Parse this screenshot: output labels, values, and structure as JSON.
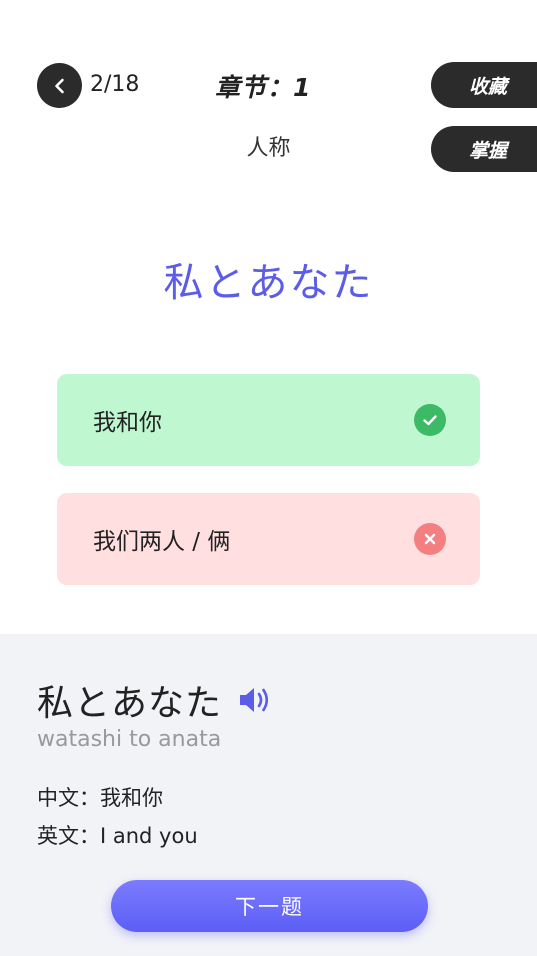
{
  "header": {
    "progress": "2/18",
    "chapter": "章节：1",
    "subtitle": "人称",
    "favorite_label": "收藏",
    "master_label": "掌握"
  },
  "question": {
    "text": "私とあなた"
  },
  "options": [
    {
      "label": "我和你",
      "status": "correct"
    },
    {
      "label": "我们两人 / 俩",
      "status": "wrong"
    }
  ],
  "detail": {
    "word": "私とあなた",
    "romaji": "watashi to anata",
    "chinese_prefix": "中文：",
    "chinese": "我和你",
    "english_prefix": "英文：",
    "english": "I and you"
  },
  "actions": {
    "next_label": "下一题"
  },
  "colors": {
    "accent": "#5b5ce8",
    "correct_bg": "#bff8d0",
    "correct_icon": "#3dba66",
    "wrong_bg": "#ffdfe0",
    "wrong_icon": "#f47f80",
    "dark": "#2b2b2b"
  }
}
